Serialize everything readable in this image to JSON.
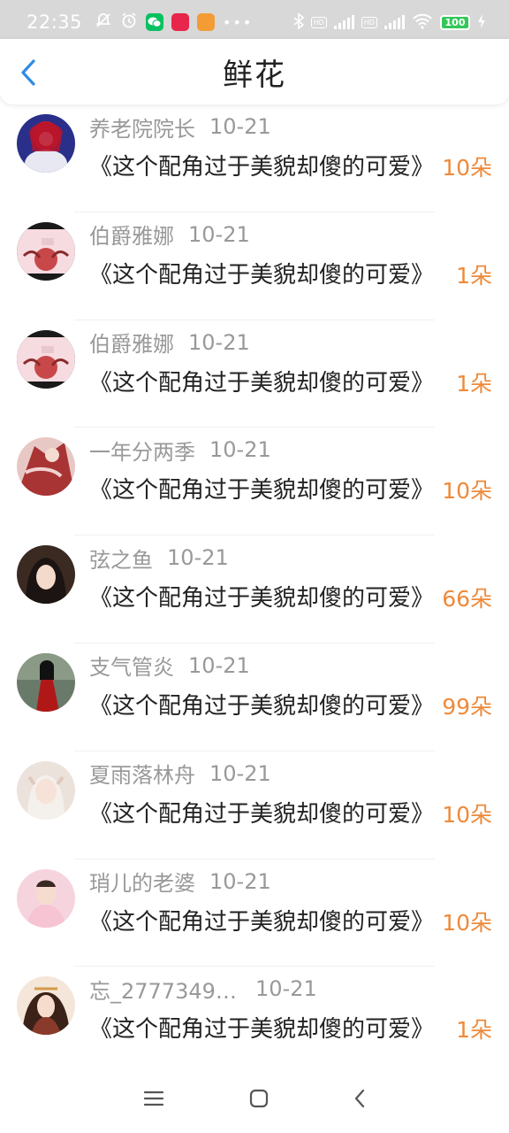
{
  "status_bar": {
    "time": "22:35",
    "battery": "100"
  },
  "header": {
    "title": "鲜花"
  },
  "items": [
    {
      "name": "养老院院长",
      "date": "10-21",
      "message": "《这个配角过于美貌却傻的可爱》",
      "flowers": "10朵"
    },
    {
      "name": "伯爵雅娜",
      "date": "10-21",
      "message": "《这个配角过于美貌却傻的可爱》",
      "flowers": "1朵"
    },
    {
      "name": "伯爵雅娜",
      "date": "10-21",
      "message": "《这个配角过于美貌却傻的可爱》",
      "flowers": "1朵"
    },
    {
      "name": "一年分两季",
      "date": "10-21",
      "message": "《这个配角过于美貌却傻的可爱》",
      "flowers": "10朵"
    },
    {
      "name": "弦之鱼",
      "date": "10-21",
      "message": "《这个配角过于美貌却傻的可爱》",
      "flowers": "66朵"
    },
    {
      "name": "支气管炎",
      "date": "10-21",
      "message": "《这个配角过于美貌却傻的可爱》",
      "flowers": "99朵"
    },
    {
      "name": "夏雨落林舟",
      "date": "10-21",
      "message": "《这个配角过于美貌却傻的可爱》",
      "flowers": "10朵"
    },
    {
      "name": "琑儿的老婆",
      "date": "10-21",
      "message": "《这个配角过于美貌却傻的可爱》",
      "flowers": "10朵"
    },
    {
      "name": "忘_2777349…",
      "date": "10-21",
      "message": "《这个配角过于美貌却傻的可爱》",
      "flowers": "1朵"
    }
  ],
  "colors": {
    "accent": "#2f8be6",
    "flower_count": "#ee8a3a",
    "meta_text": "#999999"
  },
  "icons": {
    "back": "chevron-left-icon",
    "nav_menu": "menu-icon",
    "nav_home": "home-square-icon",
    "nav_back": "back-chevron-icon"
  }
}
